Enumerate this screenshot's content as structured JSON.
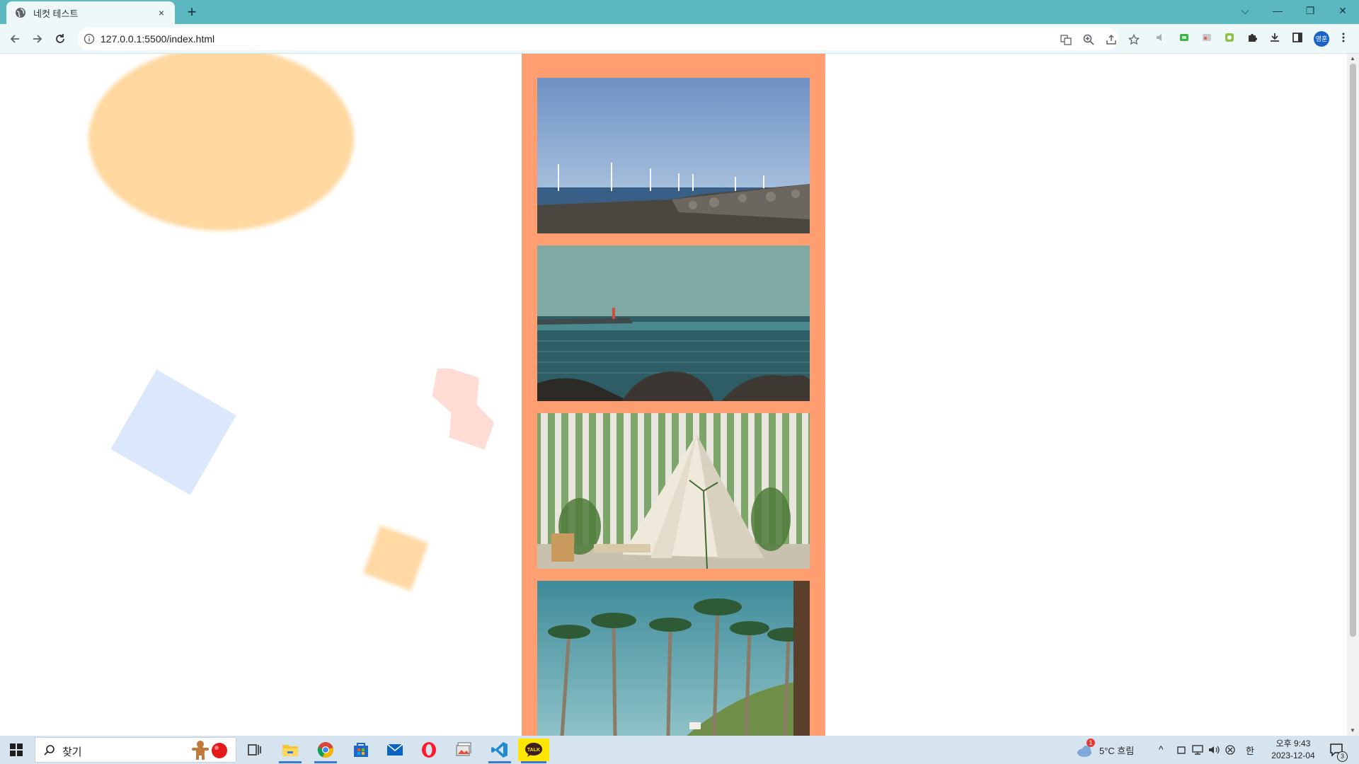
{
  "browser": {
    "tab_title": "네컷 테스트",
    "tab_close": "×",
    "new_tab": "+",
    "url": "127.0.0.1:5500/index.html",
    "profile_initials": "영훈"
  },
  "window_controls": {
    "tab_search": "⌵",
    "minimize": "—",
    "restore": "❐",
    "close": "✕"
  },
  "gallery": {
    "background": "#ff9f71",
    "photos": [
      {
        "name": "windmills-coast"
      },
      {
        "name": "sea-lighthouse"
      },
      {
        "name": "tent-birch-fence"
      },
      {
        "name": "palm-trees"
      }
    ]
  },
  "decor_colors": {
    "circle": "#ffd8a0",
    "diamond": "#dbe8fb",
    "zigzag": "#ffddd6",
    "square": "#ffd8a3"
  },
  "taskbar": {
    "search_placeholder": "찾기",
    "weather": "5°C  흐림",
    "ime": "한",
    "time": "오후 9:43",
    "date": "2023-12-04",
    "notification_count": "3",
    "weather_badge": "1"
  }
}
